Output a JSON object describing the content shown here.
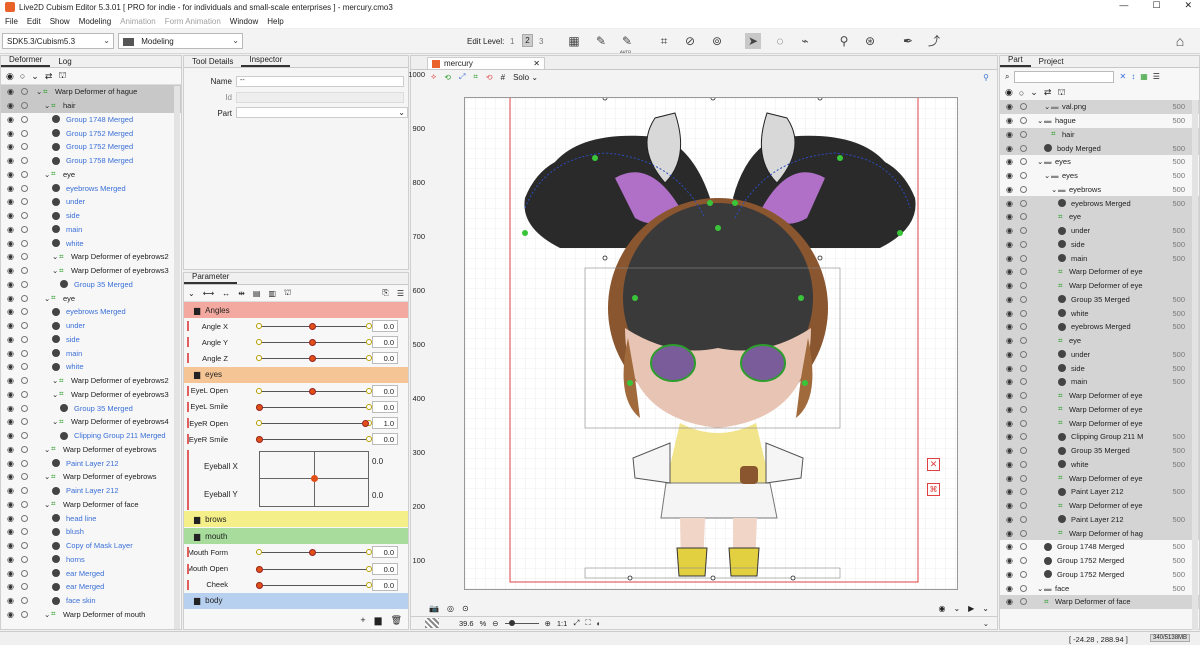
{
  "app": {
    "title": "Live2D Cubism Editor 5.3.01   [ PRO for indie - for individuals and small-scale enterprises ]  -  mercury.cmo3",
    "menu": [
      "File",
      "Edit",
      "Show",
      "Modeling",
      "Animation",
      "Form Animation",
      "Window",
      "Help"
    ],
    "menu_disabled": [
      "Animation",
      "Form Animation"
    ]
  },
  "toolbar": {
    "sdk": "SDK5.3/Cubism5.3",
    "mode": "Modeling",
    "edit_level_label": "Edit Level:",
    "edit_levels": [
      "1",
      "2",
      "3"
    ],
    "auto_label": "AUTO"
  },
  "left_panel": {
    "tabs": [
      "Deformer",
      "Log"
    ],
    "items": [
      {
        "text": "Warp Deformer of hague",
        "lvl": 0,
        "type": "warp",
        "blue": false,
        "sel": true
      },
      {
        "text": "hair",
        "lvl": 1,
        "type": "warp",
        "blue": false,
        "sel": true
      },
      {
        "text": "Group 1748 Merged",
        "lvl": 2,
        "type": "art",
        "blue": true,
        "sel": false
      },
      {
        "text": "Group 1752 Merged",
        "lvl": 2,
        "type": "art",
        "blue": true,
        "sel": false
      },
      {
        "text": "Group 1752 Merged",
        "lvl": 2,
        "type": "art",
        "blue": true,
        "sel": false
      },
      {
        "text": "Group 1758 Merged",
        "lvl": 2,
        "type": "art",
        "blue": true,
        "sel": false
      },
      {
        "text": "eye",
        "lvl": 1,
        "type": "warp",
        "blue": false,
        "sel": false
      },
      {
        "text": "eyebrows Merged",
        "lvl": 2,
        "type": "art",
        "blue": true,
        "sel": false
      },
      {
        "text": "under",
        "lvl": 2,
        "type": "art",
        "blue": true,
        "sel": false
      },
      {
        "text": "side",
        "lvl": 2,
        "type": "art",
        "blue": true,
        "sel": false
      },
      {
        "text": "main",
        "lvl": 2,
        "type": "art",
        "blue": true,
        "sel": false
      },
      {
        "text": "white",
        "lvl": 2,
        "type": "art",
        "blue": true,
        "sel": false
      },
      {
        "text": "Warp Deformer of eyebrows2",
        "lvl": 2,
        "type": "warp",
        "blue": false,
        "sel": false
      },
      {
        "text": "Warp Deformer of eyebrows3",
        "lvl": 2,
        "type": "warp",
        "blue": false,
        "sel": false
      },
      {
        "text": "Group 35 Merged",
        "lvl": 3,
        "type": "art",
        "blue": true,
        "sel": false
      },
      {
        "text": "eye",
        "lvl": 1,
        "type": "warp",
        "blue": false,
        "sel": false
      },
      {
        "text": "eyebrows Merged",
        "lvl": 2,
        "type": "art",
        "blue": true,
        "sel": false
      },
      {
        "text": "under",
        "lvl": 2,
        "type": "art",
        "blue": true,
        "sel": false
      },
      {
        "text": "side",
        "lvl": 2,
        "type": "art",
        "blue": true,
        "sel": false
      },
      {
        "text": "main",
        "lvl": 2,
        "type": "art",
        "blue": true,
        "sel": false
      },
      {
        "text": "white",
        "lvl": 2,
        "type": "art",
        "blue": true,
        "sel": false
      },
      {
        "text": "Warp Deformer of eyebrows2",
        "lvl": 2,
        "type": "warp",
        "blue": false,
        "sel": false
      },
      {
        "text": "Warp Deformer of eyebrows3",
        "lvl": 2,
        "type": "warp",
        "blue": false,
        "sel": false
      },
      {
        "text": "Group 35 Merged",
        "lvl": 3,
        "type": "art",
        "blue": true,
        "sel": false
      },
      {
        "text": "Warp Deformer of eyebrows4",
        "lvl": 2,
        "type": "warp",
        "blue": false,
        "sel": false
      },
      {
        "text": "Clipping Group 211 Merged",
        "lvl": 3,
        "type": "art",
        "blue": true,
        "sel": false
      },
      {
        "text": "Warp Deformer of eyebrows",
        "lvl": 1,
        "type": "warp",
        "blue": false,
        "sel": false
      },
      {
        "text": "Paint Layer 212",
        "lvl": 2,
        "type": "art",
        "blue": true,
        "sel": false
      },
      {
        "text": "Warp Deformer of eyebrows",
        "lvl": 1,
        "type": "warp",
        "blue": false,
        "sel": false
      },
      {
        "text": "Paint Layer 212",
        "lvl": 2,
        "type": "art",
        "blue": true,
        "sel": false
      },
      {
        "text": "Warp Deformer of face",
        "lvl": 1,
        "type": "warp",
        "blue": false,
        "sel": false
      },
      {
        "text": "head line",
        "lvl": 2,
        "type": "art",
        "blue": true,
        "sel": false
      },
      {
        "text": "blush",
        "lvl": 2,
        "type": "art",
        "blue": true,
        "sel": false
      },
      {
        "text": "Copy of Mask Layer",
        "lvl": 2,
        "type": "art",
        "blue": true,
        "sel": false
      },
      {
        "text": "horns",
        "lvl": 2,
        "type": "art",
        "blue": true,
        "sel": false
      },
      {
        "text": "ear Merged",
        "lvl": 2,
        "type": "art",
        "blue": true,
        "sel": false
      },
      {
        "text": "ear Merged",
        "lvl": 2,
        "type": "art",
        "blue": true,
        "sel": false
      },
      {
        "text": "face skin",
        "lvl": 2,
        "type": "art",
        "blue": true,
        "sel": false
      },
      {
        "text": "Warp Deformer of mouth",
        "lvl": 1,
        "type": "warp",
        "blue": false,
        "sel": false
      }
    ]
  },
  "inspector": {
    "tabs": [
      "Tool Details",
      "Inspector"
    ],
    "name_label": "Name",
    "name_value": "--",
    "id_label": "Id",
    "part_label": "Part"
  },
  "parameter": {
    "tab": "Parameter",
    "groups": [
      {
        "name": "Angles",
        "color": "#f4a9a0",
        "params": [
          {
            "label": "Angle X",
            "value": "0.0",
            "pos": 0.5
          },
          {
            "label": "Angle Y",
            "value": "0.0",
            "pos": 0.5
          },
          {
            "label": "Angle Z",
            "value": "0.0",
            "pos": 0.5
          }
        ]
      },
      {
        "name": "eyes",
        "color": "#f6c596",
        "params": [
          {
            "label": "EyeL Open",
            "value": "0.0",
            "pos": 0.5
          },
          {
            "label": "EyeL Smile",
            "value": "0.0",
            "pos": 0.0
          },
          {
            "label": "EyeR Open",
            "value": "1.0",
            "pos": 1.0
          },
          {
            "label": "EyeR Smile",
            "value": "0.0",
            "pos": 0.0
          }
        ]
      },
      {
        "name": "brows",
        "color": "#f5ef8a",
        "params": []
      },
      {
        "name": "mouth",
        "color": "#a8dc9c",
        "params": [
          {
            "label": "Mouth Form",
            "value": "0.0",
            "pos": 0.5
          },
          {
            "label": "Mouth Open",
            "value": "0.0",
            "pos": 0.0
          },
          {
            "label": "Cheek",
            "value": "0.0",
            "pos": 0.0
          }
        ]
      },
      {
        "name": "body",
        "color": "#b8d0f0",
        "params": []
      }
    ],
    "eyeball_x": {
      "label": "Eyeball X",
      "value": "0.0"
    },
    "eyeball_y": {
      "label": "Eyeball Y",
      "value": "0.0"
    }
  },
  "viewport": {
    "tab": "mercury",
    "solo_label": "Solo",
    "zoom": "39.6",
    "zoom_unit": "%",
    "ratio": "1:1",
    "ruler": [
      "1000",
      "900",
      "800",
      "700",
      "600",
      "500",
      "400",
      "300",
      "200",
      "100"
    ],
    "status_coords": "[ -24.28 ,  288.94 ]",
    "status_zoom": "340/5138MB"
  },
  "right_panel": {
    "tabs": [
      "Part",
      "Project"
    ],
    "items": [
      {
        "text": "val.png",
        "lvl": 1,
        "type": "folder",
        "val": "500",
        "sel": true
      },
      {
        "text": "hague",
        "lvl": 0,
        "type": "folder",
        "val": "500",
        "sel": false
      },
      {
        "text": "hair",
        "lvl": 2,
        "type": "warp",
        "val": "",
        "sel": true
      },
      {
        "text": "body Merged",
        "lvl": 1,
        "type": "art",
        "val": "500",
        "sel": true
      },
      {
        "text": "eyes",
        "lvl": 0,
        "type": "folder",
        "val": "500",
        "sel": false
      },
      {
        "text": "eyes",
        "lvl": 1,
        "type": "folder",
        "val": "500",
        "sel": false
      },
      {
        "text": "eyebrows",
        "lvl": 2,
        "type": "folder",
        "val": "500",
        "sel": false
      },
      {
        "text": "eyebrows Merged",
        "lvl": 3,
        "type": "art",
        "val": "500",
        "sel": true
      },
      {
        "text": "eye",
        "lvl": 3,
        "type": "warp",
        "val": "",
        "sel": true
      },
      {
        "text": "under",
        "lvl": 3,
        "type": "art",
        "val": "500",
        "sel": true
      },
      {
        "text": "side",
        "lvl": 3,
        "type": "art",
        "val": "500",
        "sel": true
      },
      {
        "text": "main",
        "lvl": 3,
        "type": "art",
        "val": "500",
        "sel": true
      },
      {
        "text": "Warp Deformer of eye",
        "lvl": 3,
        "type": "warp",
        "val": "",
        "sel": true
      },
      {
        "text": "Warp Deformer of eye",
        "lvl": 3,
        "type": "warp",
        "val": "",
        "sel": true
      },
      {
        "text": "Group 35 Merged",
        "lvl": 3,
        "type": "art",
        "val": "500",
        "sel": true
      },
      {
        "text": "white",
        "lvl": 3,
        "type": "art",
        "val": "500",
        "sel": true
      },
      {
        "text": "eyebrows Merged",
        "lvl": 3,
        "type": "art",
        "val": "500",
        "sel": true
      },
      {
        "text": "eye",
        "lvl": 3,
        "type": "warp",
        "val": "",
        "sel": true
      },
      {
        "text": "under",
        "lvl": 3,
        "type": "art",
        "val": "500",
        "sel": true
      },
      {
        "text": "side",
        "lvl": 3,
        "type": "art",
        "val": "500",
        "sel": true
      },
      {
        "text": "main",
        "lvl": 3,
        "type": "art",
        "val": "500",
        "sel": true
      },
      {
        "text": "Warp Deformer of eye",
        "lvl": 3,
        "type": "warp",
        "val": "",
        "sel": true
      },
      {
        "text": "Warp Deformer of eye",
        "lvl": 3,
        "type": "warp",
        "val": "",
        "sel": true
      },
      {
        "text": "Warp Deformer of eye",
        "lvl": 3,
        "type": "warp",
        "val": "",
        "sel": true
      },
      {
        "text": "Clipping Group 211 M",
        "lvl": 3,
        "type": "art",
        "val": "500",
        "sel": true
      },
      {
        "text": "Group 35 Merged",
        "lvl": 3,
        "type": "art",
        "val": "500",
        "sel": true
      },
      {
        "text": "white",
        "lvl": 3,
        "type": "art",
        "val": "500",
        "sel": true
      },
      {
        "text": "Warp Deformer of eye",
        "lvl": 3,
        "type": "warp",
        "val": "",
        "sel": true
      },
      {
        "text": "Paint Layer 212",
        "lvl": 3,
        "type": "art",
        "val": "500",
        "sel": true
      },
      {
        "text": "Warp Deformer of eye",
        "lvl": 3,
        "type": "warp",
        "val": "",
        "sel": true
      },
      {
        "text": "Paint Layer 212",
        "lvl": 3,
        "type": "art",
        "val": "500",
        "sel": true
      },
      {
        "text": "Warp Deformer of hag",
        "lvl": 3,
        "type": "warp",
        "val": "",
        "sel": true
      },
      {
        "text": "Group 1748 Merged",
        "lvl": 1,
        "type": "art",
        "val": "500",
        "sel": false
      },
      {
        "text": "Group 1752 Merged",
        "lvl": 1,
        "type": "art",
        "val": "500",
        "sel": false
      },
      {
        "text": "Group 1752 Merged",
        "lvl": 1,
        "type": "art",
        "val": "500",
        "sel": false
      },
      {
        "text": "face",
        "lvl": 0,
        "type": "folder",
        "val": "500",
        "sel": false
      },
      {
        "text": "Warp Deformer of face",
        "lvl": 1,
        "type": "warp",
        "val": "",
        "sel": true
      }
    ]
  },
  "colors": {
    "accent_blue": "#3a6fd8",
    "warp_green": "#2d9d2d",
    "knob": "#e05018",
    "hair_dark": "#2a2a2a"
  }
}
